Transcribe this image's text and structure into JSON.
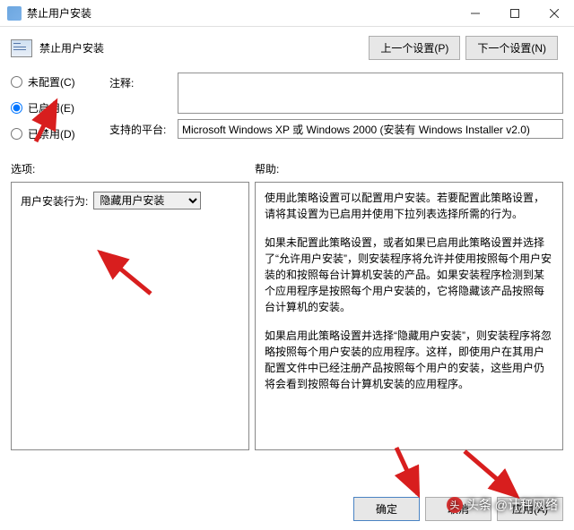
{
  "window": {
    "title": "禁止用户安装",
    "header_title": "禁止用户安装",
    "prev_setting": "上一个设置(P)",
    "next_setting": "下一个设置(N)"
  },
  "radios": {
    "not_configured": "未配置(C)",
    "enabled": "已启用(E)",
    "disabled": "已禁用(D)"
  },
  "fields": {
    "comment_label": "注释:",
    "comment_value": "",
    "platform_label": "支持的平台:",
    "platform_value": "Microsoft Windows XP 或 Windows 2000 (安装有 Windows Installer v2.0)"
  },
  "options": {
    "section_label": "选项:",
    "behavior_label": "用户安装行为:",
    "behavior_selected": "隐藏用户安装"
  },
  "help": {
    "section_label": "帮助:",
    "p1": "使用此策略设置可以配置用户安装。若要配置此策略设置，请将其设置为已启用并使用下拉列表选择所需的行为。",
    "p2": "如果未配置此策略设置，或者如果已启用此策略设置并选择了“允许用户安装”，则安装程序将允许并使用按照每个用户安装的和按照每台计算机安装的产品。如果安装程序检测到某个应用程序是按照每个用户安装的，它将隐藏该产品按照每台计算机的安装。",
    "p3": "如果启用此策略设置并选择“隐藏用户安装”，则安装程序将忽略按照每个用户安装的应用程序。这样，即使用户在其用户配置文件中已经注册产品按照每个用户的安装，这些用户仍将会看到按照每台计算机安装的应用程序。"
  },
  "footer": {
    "ok": "确定",
    "cancel": "取消",
    "apply": "应用(A)"
  },
  "watermark": "头条 @计秤网络"
}
